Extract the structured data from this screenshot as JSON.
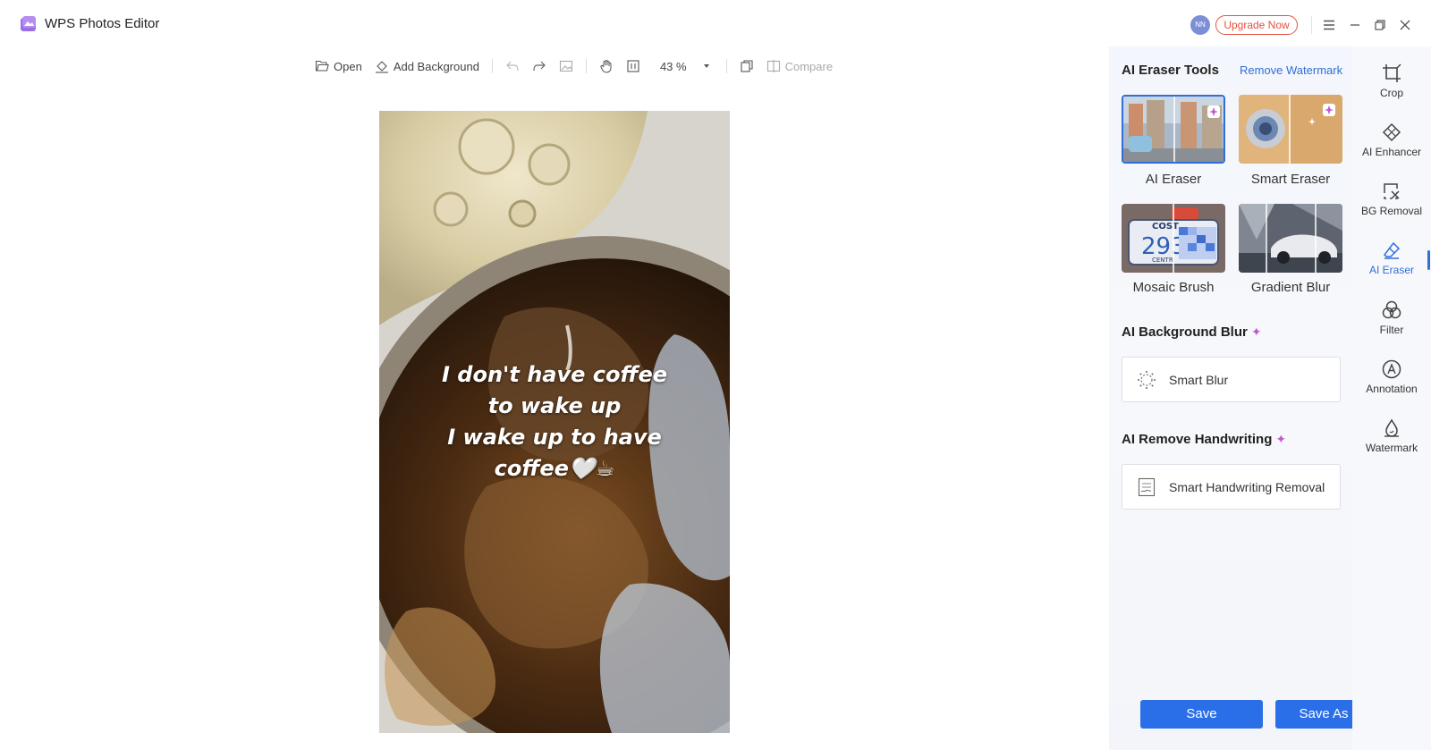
{
  "app": {
    "title": "WPS Photos Editor"
  },
  "header": {
    "avatar_initials": "NN",
    "upgrade_label": "Upgrade Now"
  },
  "toolbar": {
    "open_label": "Open",
    "add_background_label": "Add Background",
    "zoom": "43 %",
    "compare_label": "Compare"
  },
  "photo": {
    "caption": "I don't have coffee\nto wake up\nI wake up to have\ncoffee🤍☕"
  },
  "panel": {
    "eraser_tools_title": "AI Eraser Tools",
    "remove_watermark_link": "Remove Watermark",
    "tools": [
      {
        "label": "AI Eraser",
        "active": true
      },
      {
        "label": "Smart Eraser",
        "active": false
      },
      {
        "label": "Mosaic Brush",
        "active": false
      },
      {
        "label": "Gradient Blur",
        "active": false
      }
    ],
    "background_blur_title": "AI Background Blur",
    "smart_blur_label": "Smart Blur",
    "remove_handwriting_title": "AI Remove Handwriting",
    "handwriting_removal_label": "Smart Handwriting Removal",
    "mosaic_thumb_text": "293",
    "mosaic_thumb_top": "COST",
    "mosaic_thumb_bottom": "CENTR",
    "save_label": "Save",
    "save_as_label": "Save As"
  },
  "rail": {
    "items": [
      {
        "label": "Crop",
        "icon": "crop-icon"
      },
      {
        "label": "AI Enhancer",
        "icon": "enhancer-icon"
      },
      {
        "label": "BG Removal",
        "icon": "bg-removal-icon"
      },
      {
        "label": "AI Eraser",
        "icon": "eraser-icon",
        "active": true
      },
      {
        "label": "Filter",
        "icon": "filter-icon"
      },
      {
        "label": "Annotation",
        "icon": "annotation-icon"
      },
      {
        "label": "Watermark",
        "icon": "watermark-icon"
      }
    ]
  },
  "colors": {
    "accent": "#2b6fe8",
    "upgrade": "#e0533f",
    "sparkle": "#c05ad0"
  }
}
